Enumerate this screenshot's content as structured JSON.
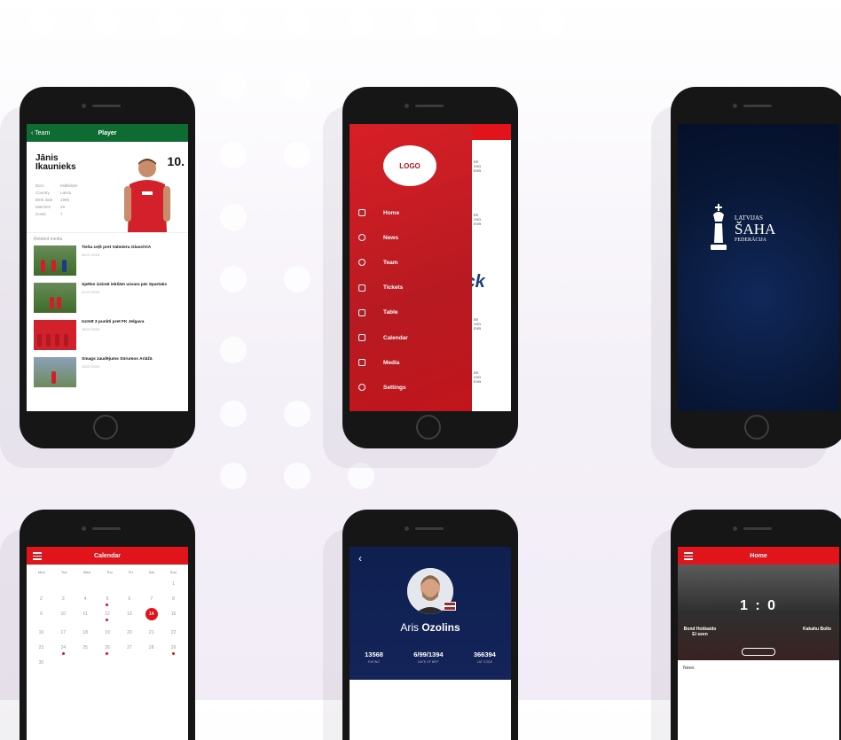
{
  "phone1": {
    "back_label": "Team",
    "header_title": "Player",
    "player_name": "Jānis Ikaunieks",
    "player_number": "10.",
    "related_label": "Related media",
    "info": [
      {
        "label": "Born",
        "value": "Midfielder"
      },
      {
        "label": "Country",
        "value": "Latvia"
      },
      {
        "label": "Birth date",
        "value": "1995"
      },
      {
        "label": "Matches",
        "value": "28"
      },
      {
        "label": "Goals",
        "value": "7"
      }
    ],
    "news": [
      {
        "title": "Tieša ceļš pret Valmieru Glass/ViA",
        "date": "26.07.2019"
      },
      {
        "title": "Spēles izzināt iekšām uzvara pār Spartaks",
        "date": "22.07.2019"
      },
      {
        "title": "Izcīnīt 3 punkti pret FK Jelgava",
        "date": "18.07.2019"
      },
      {
        "title": "Smags zaudējums Sūrumos Ariāžā",
        "date": "10.07.2019"
      }
    ]
  },
  "phone2": {
    "logo_text": "LOGO",
    "menu": [
      "Home",
      "News",
      "Team",
      "Tickets",
      "Table",
      "Calendar",
      "Media",
      "Settings"
    ],
    "background_text": "ick"
  },
  "phone3": {
    "line1": "LATVIJAS",
    "line2": "ŠAHA",
    "line3": "FEDERĀCIJA"
  },
  "phone4": {
    "header_title": "Calendar",
    "weekdays": [
      "Mon",
      "Tue",
      "Wed",
      "Thu",
      "Fri",
      "Sat",
      "Sun"
    ],
    "days": [
      "",
      "",
      "",
      "",
      "",
      "",
      "1",
      "2",
      "3",
      "4",
      "5",
      "6",
      "7",
      "8",
      "9",
      "10",
      "11",
      "12",
      "13",
      "14",
      "15",
      "16",
      "17",
      "18",
      "19",
      "20",
      "21",
      "22",
      "23",
      "24",
      "25",
      "26",
      "27",
      "28",
      "29",
      "30",
      "",
      "",
      "",
      "",
      "",
      ""
    ],
    "selected_day": "14"
  },
  "phone5": {
    "back_icon": "‹",
    "first_name": "Aris",
    "last_name": "Ozolins",
    "stats": [
      {
        "value": "13568",
        "label": "RATING"
      },
      {
        "value": "6/99/1394",
        "label": "DATE OF BIRT"
      },
      {
        "value": "366394",
        "label": "LAT CODE"
      }
    ]
  },
  "phone6": {
    "header_title": "Home",
    "score": "1 : 0",
    "team_left": "Bond Hokkaido Ei seen",
    "team_right": "Kakahu Bollo",
    "news_label": "News"
  },
  "colors": {
    "green": "#0e6b32",
    "red": "#e2141b",
    "navy": "#0e1f4f"
  }
}
